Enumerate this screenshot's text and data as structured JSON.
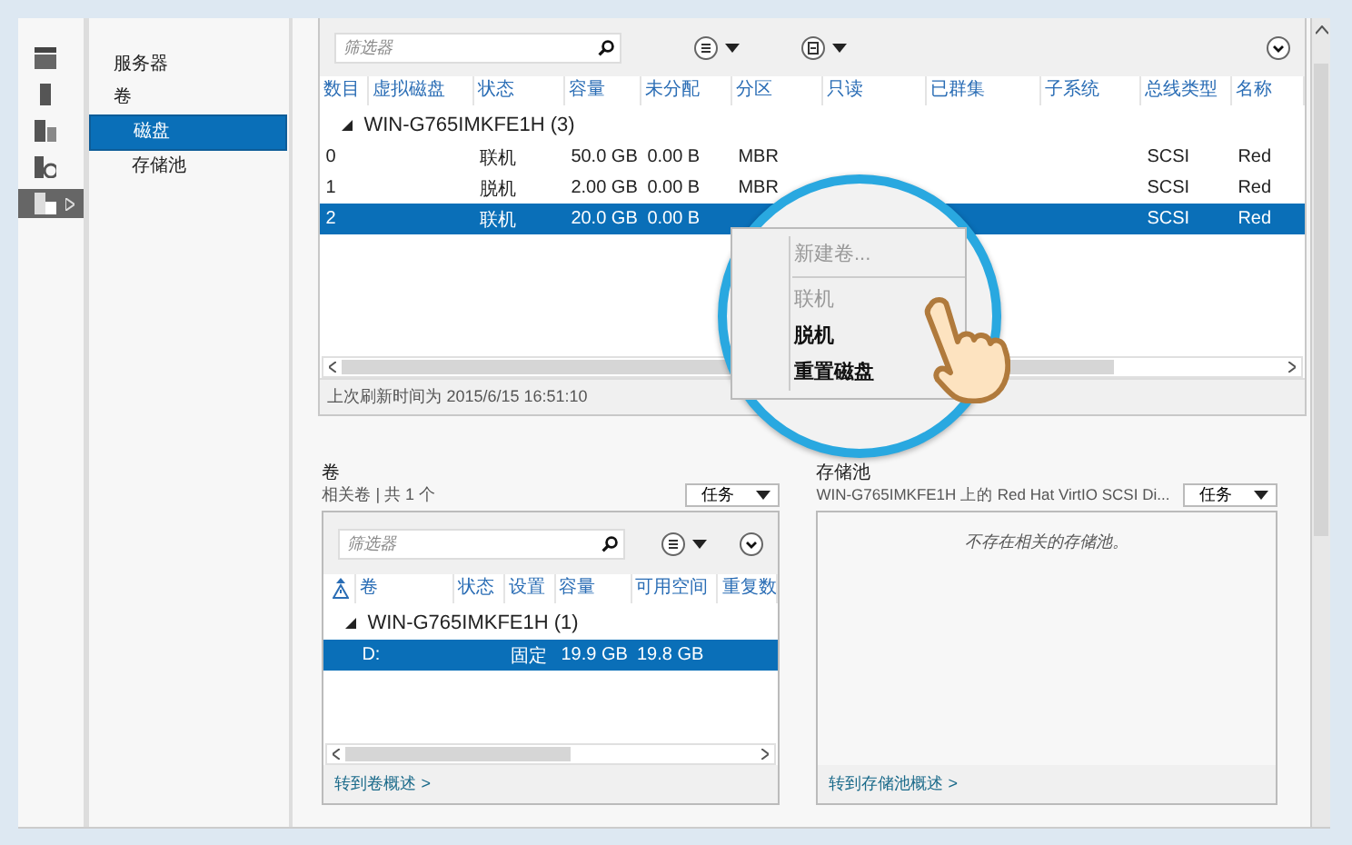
{
  "icon_bar": [
    {
      "selected": false
    },
    {
      "selected": false
    },
    {
      "selected": false
    },
    {
      "selected": false
    },
    {
      "selected": true
    }
  ],
  "nav": [
    {
      "label": "服务器",
      "selected": false
    },
    {
      "label": "卷",
      "selected": false,
      "children": [
        {
          "label": "磁盘",
          "selected": true
        },
        {
          "label": "存储池",
          "selected": false
        }
      ]
    }
  ],
  "disks": {
    "filter": {
      "placeholder": "筛选器"
    },
    "columns": [
      "数目",
      "虚拟磁盘",
      "状态",
      "容量",
      "未分配",
      "分区",
      "只读",
      "已群集",
      "子系统",
      "总线类型",
      "名称"
    ],
    "group": "WIN-G765IMKFE1H (3)",
    "rows": [
      {
        "cells": [
          "0",
          null,
          "联机",
          "50.0 GB",
          "0.00 B",
          "MBR",
          null,
          null,
          null,
          "SCSI",
          "Red"
        ],
        "selected": false
      },
      {
        "cells": [
          "1",
          null,
          "脱机",
          "2.00 GB",
          "0.00 B",
          "MBR",
          null,
          null,
          null,
          "SCSI",
          "Red"
        ],
        "selected": false
      },
      {
        "cells": [
          "2",
          null,
          "联机",
          "20.0 GB",
          "0.00 B",
          null,
          null,
          null,
          null,
          "SCSI",
          "Red"
        ],
        "selected": true
      }
    ],
    "status": "上次刷新时间为 2015/6/15 16:51:10"
  },
  "context_menu": [
    {
      "label": "新建卷...",
      "disabled": true
    },
    {
      "label": "联机",
      "disabled": true
    },
    {
      "label": "脱机",
      "disabled": false
    },
    {
      "label": "重置磁盘",
      "disabled": false
    }
  ],
  "volumes": {
    "title": "卷",
    "subtitle": "相关卷 | 共 1 个",
    "tasks": "任务",
    "filter": {
      "placeholder": "筛选器"
    },
    "columns": [
      "卷",
      "状态",
      "设置",
      "容量",
      "可用空间",
      "重复数"
    ],
    "group": "WIN-G765IMKFE1H (1)",
    "rows": [
      {
        "cells": [
          "D:",
          null,
          "固定",
          "19.9 GB",
          "19.8 GB",
          null
        ],
        "selected": true
      }
    ],
    "link": "转到卷概述 >"
  },
  "pools": {
    "title": "存储池",
    "subtitle": "WIN-G765IMKFE1H 上的 Red Hat VirtIO SCSI Di...",
    "tasks": "任务",
    "empty": "不存在相关的存储池。",
    "link": "转到存储池概述 >"
  }
}
